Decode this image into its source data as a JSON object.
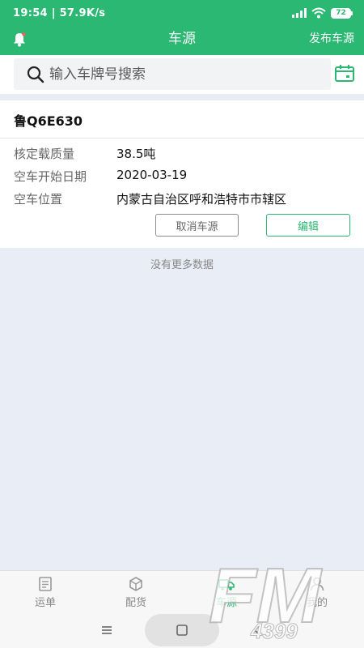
{
  "status": {
    "time": "19:54 | 57.9K/s",
    "battery": "72"
  },
  "nav": {
    "title": "车源",
    "action": "发布车源"
  },
  "search": {
    "placeholder": "输入车牌号搜索"
  },
  "vehicle": {
    "plate": "鲁Q6E630",
    "rows": [
      {
        "label": "核定载质量",
        "value": "38.5吨"
      },
      {
        "label": "空车开始日期",
        "value": "2020-03-19"
      },
      {
        "label": "空车位置",
        "value": "内蒙古自治区呼和浩特市市辖区"
      }
    ],
    "cancel_label": "取消车源",
    "edit_label": "编辑"
  },
  "list_footer": "没有更多数据",
  "tabs": [
    {
      "label": "运单",
      "icon": "waybill-icon"
    },
    {
      "label": "配货",
      "icon": "box-icon"
    },
    {
      "label": "车源",
      "icon": "truck-icon"
    },
    {
      "label": "我的",
      "icon": "user-icon"
    }
  ],
  "watermark": {
    "text": "FM",
    "sub": "4399"
  },
  "colors": {
    "brand": "#2bb873",
    "background": "#e9edf5"
  }
}
